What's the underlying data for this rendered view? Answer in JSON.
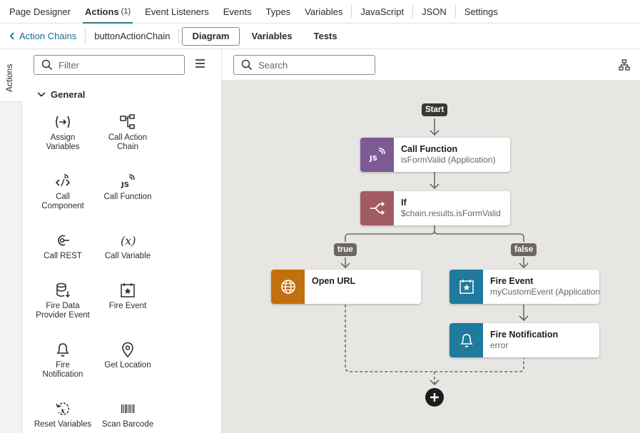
{
  "topnav": {
    "tabs": [
      {
        "label": "Page Designer"
      },
      {
        "label": "Actions",
        "count": "(1)"
      },
      {
        "label": "Event Listeners"
      },
      {
        "label": "Events"
      },
      {
        "label": "Types"
      },
      {
        "label": "Variables"
      },
      {
        "label": "JavaScript"
      },
      {
        "label": "JSON"
      },
      {
        "label": "Settings"
      }
    ]
  },
  "subbar": {
    "back_label": "Action Chains",
    "chain_name": "buttonActionChain",
    "tabs": [
      "Diagram",
      "Variables",
      "Tests"
    ]
  },
  "rail": {
    "label": "Actions"
  },
  "palette": {
    "filter_placeholder": "Filter",
    "section": "General",
    "items": [
      {
        "l1": "Assign",
        "l2": "Variables",
        "icon": "assign-variables-icon"
      },
      {
        "l1": "Call Action",
        "l2": "Chain",
        "icon": "call-action-chain-icon"
      },
      {
        "l1": "Call",
        "l2": "Component",
        "icon": "call-component-icon"
      },
      {
        "l1": "Call Function",
        "l2": "",
        "icon": "call-function-icon"
      },
      {
        "l1": "Call REST",
        "l2": "",
        "icon": "call-rest-icon"
      },
      {
        "l1": "Call Variable",
        "l2": "",
        "icon": "call-variable-icon"
      },
      {
        "l1": "Fire Data",
        "l2": "Provider Event",
        "icon": "fire-data-provider-icon"
      },
      {
        "l1": "Fire Event",
        "l2": "",
        "icon": "fire-event-icon"
      },
      {
        "l1": "Fire",
        "l2": "Notification",
        "icon": "bell-icon"
      },
      {
        "l1": "Get Location",
        "l2": "",
        "icon": "location-pin-icon"
      },
      {
        "l1": "Reset Variables",
        "l2": "",
        "icon": "reset-variables-icon"
      },
      {
        "l1": "Scan Barcode",
        "l2": "",
        "icon": "barcode-icon"
      }
    ]
  },
  "canvas": {
    "search_placeholder": "Search",
    "start_label": "Start",
    "true_label": "true",
    "false_label": "false",
    "nodes": {
      "call_function": {
        "title": "Call Function",
        "sub": "isFormValid (Application)",
        "color": "#7d5a93"
      },
      "if": {
        "title": "If",
        "sub": "$chain.results.isFormValid",
        "color": "#a35b63"
      },
      "open_url": {
        "title": "Open URL",
        "sub": "",
        "color": "#c2700f"
      },
      "fire_event": {
        "title": "Fire Event",
        "sub": "myCustomEvent (Application)",
        "color": "#1f7a9e"
      },
      "fire_notification": {
        "title": "Fire Notification",
        "sub": "error",
        "color": "#1f7a9e"
      }
    }
  }
}
